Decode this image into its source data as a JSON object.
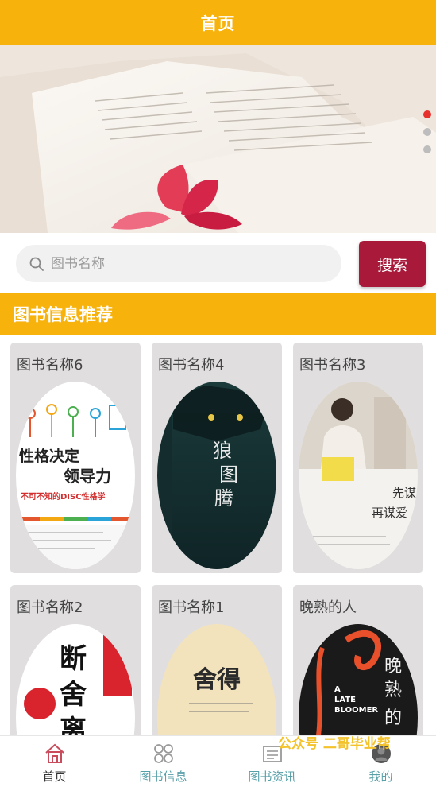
{
  "header": {
    "title": "首页"
  },
  "banner": {
    "slide_count": 3,
    "active_slide": 1
  },
  "search": {
    "placeholder": "图书名称",
    "value": "",
    "button_label": "搜索"
  },
  "section": {
    "title": "图书信息推荐"
  },
  "books": [
    {
      "name": "图书名称6",
      "cover_title": "性格决定领导力",
      "cover_subtitle": "不可不知的DISC性格学"
    },
    {
      "name": "图书名称4",
      "cover_title": "狼图腾"
    },
    {
      "name": "图书名称3",
      "cover_title": "先谋生，再谋爱"
    },
    {
      "name": "图书名称2",
      "cover_title": "断舍离"
    },
    {
      "name": "图书名称1",
      "cover_title": "舍得"
    },
    {
      "name": "晚熟的人",
      "cover_title": "晚熟的人",
      "cover_subtitle": "A LATE BLOOMER"
    }
  ],
  "tabbar": {
    "items": [
      {
        "label": "首页",
        "icon": "home-icon",
        "active": true
      },
      {
        "label": "图书信息",
        "icon": "grid-icon",
        "active": false
      },
      {
        "label": "图书资讯",
        "icon": "news-icon",
        "active": false
      },
      {
        "label": "我的",
        "icon": "user-icon",
        "active": false
      }
    ]
  },
  "watermark": {
    "text": "公众号 二哥毕业帮"
  },
  "colors": {
    "primary": "#f7b20c",
    "search_button": "#a8193a",
    "tab_text": "#58a0a8",
    "active_dot": "#e7302b"
  }
}
